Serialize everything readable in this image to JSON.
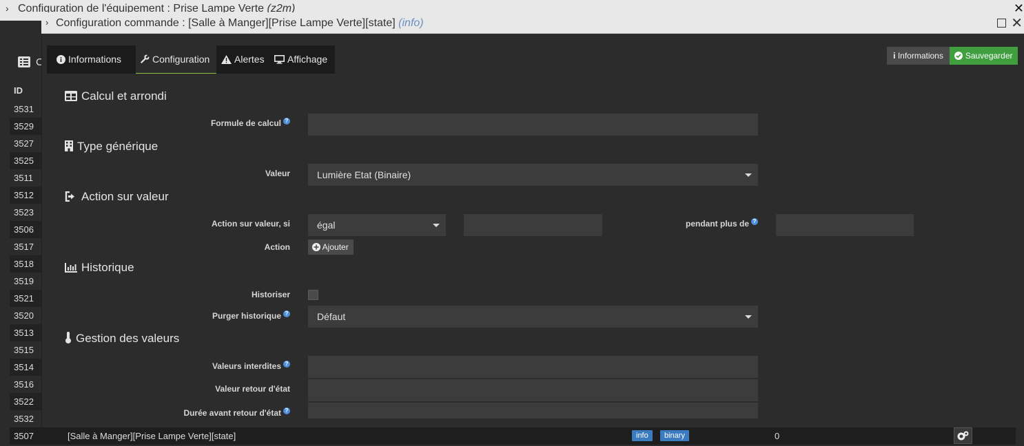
{
  "back_window": {
    "title": "Configuration de l'équipement : Prise Lampe Verte",
    "title_suffix": "(z2m)",
    "section_letter": "C",
    "id_header": "ID",
    "ids": [
      "3531",
      "3529",
      "3527",
      "3525",
      "3511",
      "3512",
      "3523",
      "3506",
      "3517",
      "3518",
      "3519",
      "3521",
      "3520",
      "3513",
      "3515",
      "3514",
      "3516",
      "3522",
      "3532"
    ],
    "bottom_row": {
      "id": "3507",
      "name": "[Salle à Manger][Prise Lampe Verte][state]",
      "type_badge": "info",
      "subtype_badge": "binary",
      "value": "0"
    }
  },
  "dialog": {
    "title": "Configuration commande : [Salle à Manger][Prise Lampe Verte][state]",
    "title_type": "(info)",
    "tabs": [
      {
        "label": "Informations",
        "icon": "info-circle-icon"
      },
      {
        "label": "Configuration",
        "icon": "wrench-icon",
        "active": true
      },
      {
        "label": "Alertes",
        "icon": "warning-icon"
      },
      {
        "label": "Affichage",
        "icon": "monitor-icon"
      }
    ],
    "buttons": {
      "info_label": "Informations",
      "save_label": "Sauvegarder"
    },
    "sections": {
      "calc": {
        "title": "Calcul et arrondi",
        "formula_label": "Formule de calcul",
        "formula_value": ""
      },
      "generic": {
        "title": "Type générique",
        "value_label": "Valeur",
        "value_selected": "Lumière Etat (Binaire)"
      },
      "action": {
        "title": "Action sur valeur",
        "condition_label": "Action sur valeur, si",
        "operator_selected": "égal",
        "compare_value": "",
        "duration_label": "pendant plus de",
        "duration_value": "",
        "action_label": "Action",
        "add_label": "Ajouter"
      },
      "history": {
        "title": "Historique",
        "historize_label": "Historiser",
        "historize_checked": false,
        "purge_label": "Purger historique",
        "purge_selected": "Défaut"
      },
      "values": {
        "title": "Gestion des valeurs",
        "forbidden_label": "Valeurs interdites",
        "forbidden_value": "",
        "return_label": "Valeur retour d'état",
        "return_value": "",
        "delay_label": "Durée avant retour d'état",
        "delay_value": ""
      }
    }
  },
  "colors": {
    "save_button": "#3f9f3f",
    "badge": "#3b7bbf",
    "tab_active_underline": "#8fc143",
    "help_icon": "#4d8fdc"
  }
}
